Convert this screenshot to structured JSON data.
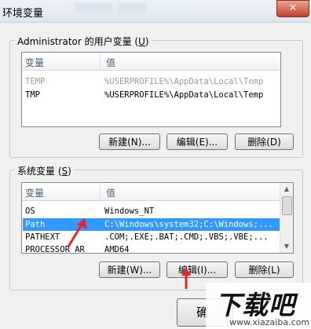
{
  "window": {
    "title": "环境变量",
    "close_glyph": "✕"
  },
  "user_vars": {
    "group_label_prefix": "Administrator 的用户变量 (",
    "group_label_key": "U",
    "group_label_suffix": ")",
    "columns": [
      "变量",
      "值"
    ],
    "rows": [
      {
        "name": "TEMP",
        "value": "%USERPROFILE%\\AppData\\Local\\Temp"
      },
      {
        "name": "TMP",
        "value": "%USERPROFILE%\\AppData\\Local\\Temp"
      }
    ],
    "buttons": {
      "new": "新建(N)...",
      "edit": "编辑(E)...",
      "delete": "删除(D)"
    }
  },
  "system_vars": {
    "group_label_prefix": "系统变量 (",
    "group_label_key": "S",
    "group_label_suffix": ")",
    "columns": [
      "变量",
      "值"
    ],
    "rows": [
      {
        "name": "OS",
        "value": "Windows_NT"
      },
      {
        "name": "Path",
        "value": "C:\\Windows\\system32;C:\\Windows;..."
      },
      {
        "name": "PATHEXT",
        "value": ".COM;.EXE;.BAT;.CMD;.VBS;.VBE;..."
      },
      {
        "name": "PROCESSOR_AR",
        "value": "AMD64"
      }
    ],
    "selected_row": "Path",
    "buttons": {
      "new": "新建(W)...",
      "edit": "编辑(I)...",
      "delete": "删除(L)"
    }
  },
  "footer": {
    "ok_partial": "确"
  },
  "watermark": {
    "logo": "下载吧",
    "url": "www.xiazaiba.com"
  },
  "annotation_color": "#e8242a",
  "selection_color": "#3399ff"
}
